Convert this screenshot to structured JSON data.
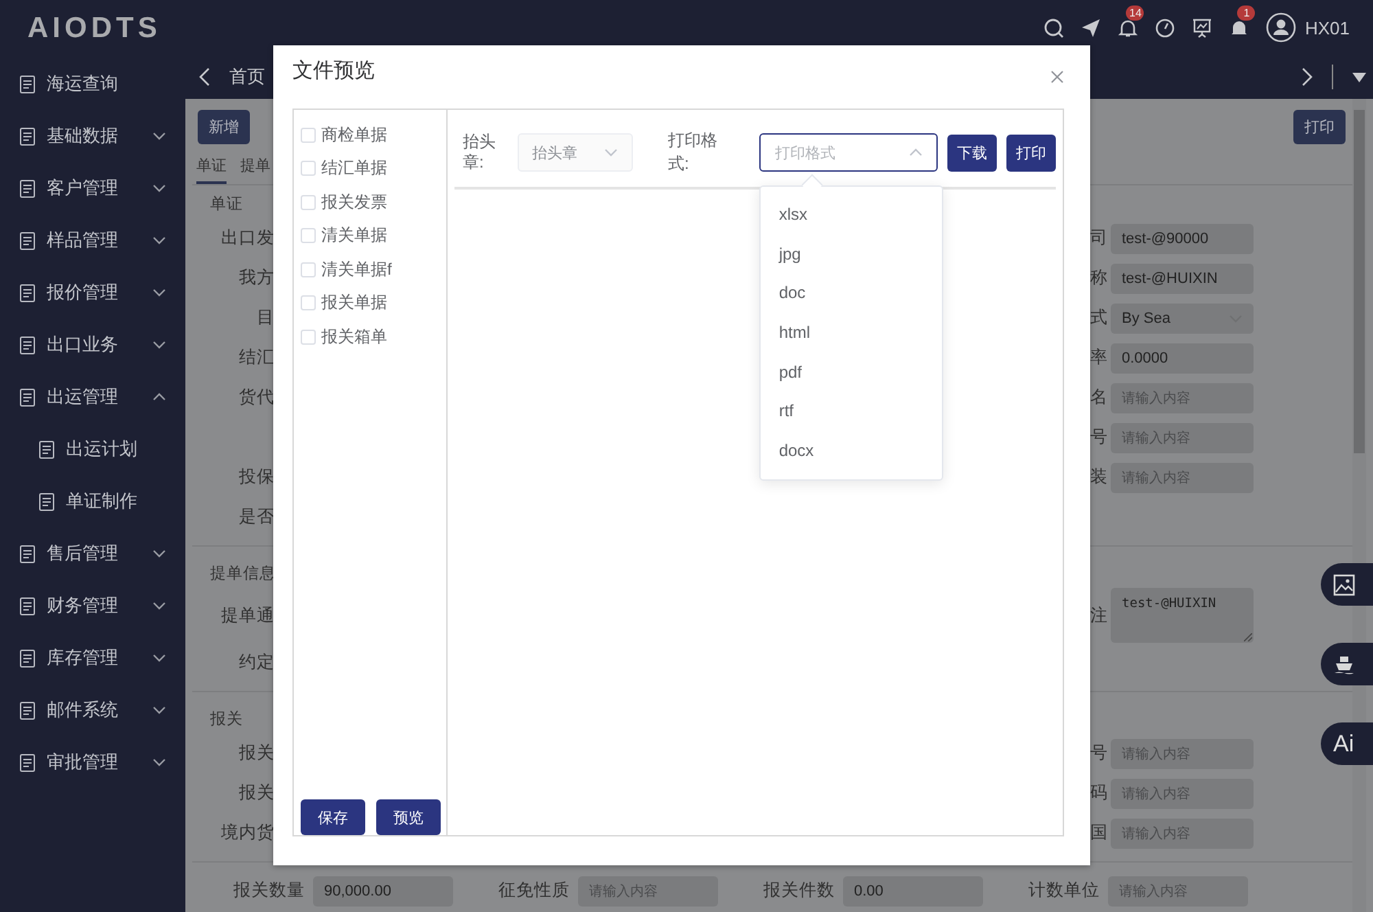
{
  "brand": "AIODTS",
  "header": {
    "badges": [
      "14",
      "1"
    ],
    "user": "HX01"
  },
  "sidebar": {
    "items": [
      {
        "label": "海运查询",
        "kind": "link"
      },
      {
        "label": "基础数据",
        "kind": "group",
        "expanded": false
      },
      {
        "label": "客户管理",
        "kind": "group",
        "expanded": false
      },
      {
        "label": "样品管理",
        "kind": "group",
        "expanded": false
      },
      {
        "label": "报价管理",
        "kind": "group",
        "expanded": false
      },
      {
        "label": "出口业务",
        "kind": "group",
        "expanded": false
      },
      {
        "label": "出运管理",
        "kind": "group",
        "expanded": true,
        "children": [
          {
            "label": "出运计划"
          },
          {
            "label": "单证制作"
          }
        ]
      },
      {
        "label": "售后管理",
        "kind": "group",
        "expanded": false
      },
      {
        "label": "财务管理",
        "kind": "group",
        "expanded": false
      },
      {
        "label": "库存管理",
        "kind": "group",
        "expanded": false
      },
      {
        "label": "邮件系统",
        "kind": "group",
        "expanded": false
      },
      {
        "label": "审批管理",
        "kind": "group",
        "expanded": false
      }
    ]
  },
  "tabs_bar": {
    "tabs": [
      "首页"
    ]
  },
  "page": {
    "toolbar": [
      "新增"
    ],
    "print_button": "打印",
    "tabs": [
      {
        "label": "单证",
        "selected": true
      },
      {
        "label": "提单",
        "selected": false
      }
    ],
    "sections": [
      {
        "title": "单证",
        "rows": [
          {
            "left_label": "出口发",
            "right_label": "司",
            "right_field": {
              "kind": "input",
              "value": "test-@90000"
            }
          },
          {
            "left_label": "我方",
            "right_label": "称",
            "right_field": {
              "kind": "input",
              "value": "test-@HUIXIN"
            }
          },
          {
            "left_label": "目",
            "right_label": "式",
            "right_field": {
              "kind": "select",
              "value": "By Sea"
            }
          },
          {
            "left_label": "结汇",
            "right_label": "率",
            "right_field": {
              "kind": "input",
              "value": "0.0000"
            }
          },
          {
            "left_label": "货代",
            "right_label": "名",
            "right_field": {
              "kind": "input",
              "placeholder": "请输入内容"
            }
          },
          {
            "right_label": "号",
            "right_field": {
              "kind": "input",
              "placeholder": "请输入内容"
            }
          },
          {
            "left_label": "投保",
            "right_label": "装",
            "right_field": {
              "kind": "input",
              "placeholder": "请输入内容"
            }
          },
          {
            "left_label": "是否"
          }
        ]
      },
      {
        "title": "提单信息",
        "rows": [
          {
            "left_label": "提单通",
            "right_label": "注",
            "right_field": {
              "kind": "textarea",
              "value": "test-@HUIXIN"
            }
          },
          {
            "left_label": "约定"
          }
        ]
      },
      {
        "title": "报关",
        "rows": [
          {
            "left_label": "报关",
            "right_label": "号",
            "right_field": {
              "kind": "input",
              "placeholder": "请输入内容"
            }
          },
          {
            "left_label": "报关",
            "right_label": "码",
            "right_field": {
              "kind": "input",
              "placeholder": "请输入内容"
            }
          },
          {
            "left_label": "境内货",
            "right_label": "国",
            "right_field": {
              "kind": "input",
              "placeholder": "请输入内容"
            }
          }
        ]
      }
    ],
    "summary_row": [
      {
        "label": "报关数量",
        "field": {
          "kind": "input",
          "value": "90,000.00"
        }
      },
      {
        "label": "征免性质",
        "field": {
          "kind": "input",
          "placeholder": "请输入内容"
        }
      },
      {
        "label": "报关件数",
        "field": {
          "kind": "input",
          "value": "0.00"
        }
      },
      {
        "label": "计数单位",
        "field": {
          "kind": "input",
          "placeholder": "请输入内容"
        }
      }
    ]
  },
  "dialog": {
    "title": "文件预览",
    "documents": [
      {
        "label": "商检单据",
        "checked": false
      },
      {
        "label": "结汇单据",
        "checked": false
      },
      {
        "label": "报关发票",
        "checked": false
      },
      {
        "label": "清关单据",
        "checked": false
      },
      {
        "label": "清关单据f",
        "checked": false
      },
      {
        "label": "报关单据",
        "checked": false
      },
      {
        "label": "报关箱单",
        "checked": false
      }
    ],
    "buttons": [
      "保存",
      "预览"
    ],
    "letterhead": {
      "label": "抬头章:",
      "placeholder": "抬头章",
      "disabled": true
    },
    "format": {
      "label": "打印格式:",
      "placeholder": "打印格式",
      "expanded": true,
      "options": [
        "xlsx",
        "jpg",
        "doc",
        "html",
        "pdf",
        "rtf",
        "docx"
      ]
    },
    "actions": [
      "下载",
      "打印"
    ]
  },
  "float_tools": {
    "ai_label": "Ai"
  }
}
